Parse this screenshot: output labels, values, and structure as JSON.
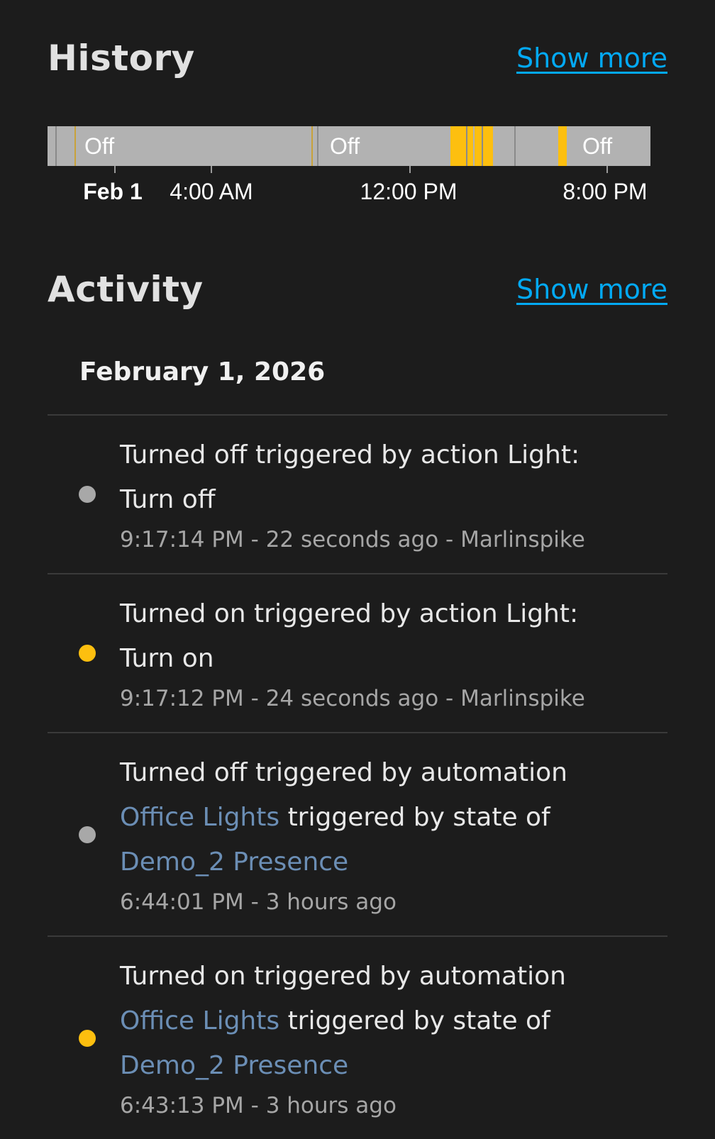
{
  "history": {
    "title": "History",
    "show_more": "Show more",
    "timeline": {
      "segments": [
        {
          "state": "off",
          "start": 0.0,
          "end": 0.44,
          "label": "Off"
        },
        {
          "state": "off",
          "start": 0.44,
          "end": 0.68,
          "label": "Off"
        },
        {
          "state": "on",
          "start": 0.68,
          "end": 0.755
        },
        {
          "state": "off",
          "start": 0.755,
          "end": 0.87
        },
        {
          "state": "on",
          "start": 0.87,
          "end": 0.884
        },
        {
          "state": "off",
          "start": 0.884,
          "end": 1.0,
          "label": "Off"
        }
      ],
      "ticks": [
        {
          "label": "Feb 1",
          "pos": 0.115,
          "bold": true
        },
        {
          "label": "4:00 AM",
          "pos": 0.28,
          "bold": false
        },
        {
          "label": "12:00 PM",
          "pos": 0.613,
          "bold": false
        },
        {
          "label": "8:00 PM",
          "pos": 0.946,
          "bold": false
        }
      ],
      "colors": {
        "on": "#fdbf0f",
        "off": "#b2b2b2"
      }
    }
  },
  "activity": {
    "title": "Activity",
    "show_more": "Show more",
    "date": "February 1, 2026",
    "entries": [
      {
        "state": "off",
        "line1": "Turned off triggered by action Light:",
        "line2": "Turn off",
        "meta": "9:17:14 PM - 22 seconds ago - Marlinspike"
      },
      {
        "state": "on",
        "line1": "Turned on triggered by action Light:",
        "line2": "Turn on",
        "meta": "9:17:12 PM - 24 seconds ago - Marlinspike"
      },
      {
        "state": "off",
        "line1": "Turned off triggered by automation",
        "link1": "Office Lights",
        "mid": " triggered by state of",
        "link2": "Demo_2 Presence",
        "meta": "6:44:01 PM - 3 hours ago"
      },
      {
        "state": "on",
        "line1": "Turned on triggered by automation",
        "link1": "Office Lights",
        "mid": " triggered by state of",
        "link2": "Demo_2 Presence",
        "meta": "6:43:13 PM - 3 hours ago"
      }
    ]
  }
}
